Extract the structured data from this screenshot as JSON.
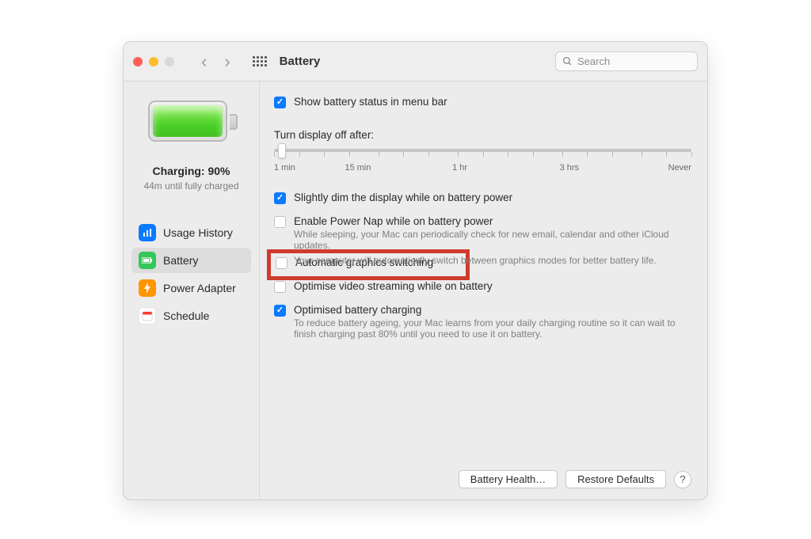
{
  "header": {
    "title": "Battery",
    "search_placeholder": "Search"
  },
  "sidebar": {
    "status_title": "Charging: 90%",
    "status_sub": "44m until fully charged",
    "items": [
      {
        "label": "Usage History"
      },
      {
        "label": "Battery"
      },
      {
        "label": "Power Adapter"
      },
      {
        "label": "Schedule"
      }
    ]
  },
  "options": {
    "menu_bar_label": "Show battery status in menu bar",
    "slider_title": "Turn display off after:",
    "slider_ticks": [
      "1 min",
      "15 min",
      "1 hr",
      "3 hrs",
      "Never"
    ],
    "dim_label": "Slightly dim the display while on battery power",
    "powernap_label": "Enable Power Nap while on battery power",
    "powernap_desc": "While sleeping, your Mac can periodically check for new email, calendar and other iCloud updates.",
    "gfx_label": "Automatic graphics switching",
    "gfx_desc": "Your computer will automatically switch between graphics modes for better battery life.",
    "video_label": "Optimise video streaming while on battery",
    "charging_label": "Optimised battery charging",
    "charging_desc": "To reduce battery ageing, your Mac learns from your daily charging routine so it can wait to finish charging past 80% until you need to use it on battery."
  },
  "footer": {
    "health": "Battery Health…",
    "restore": "Restore Defaults",
    "help": "?"
  }
}
